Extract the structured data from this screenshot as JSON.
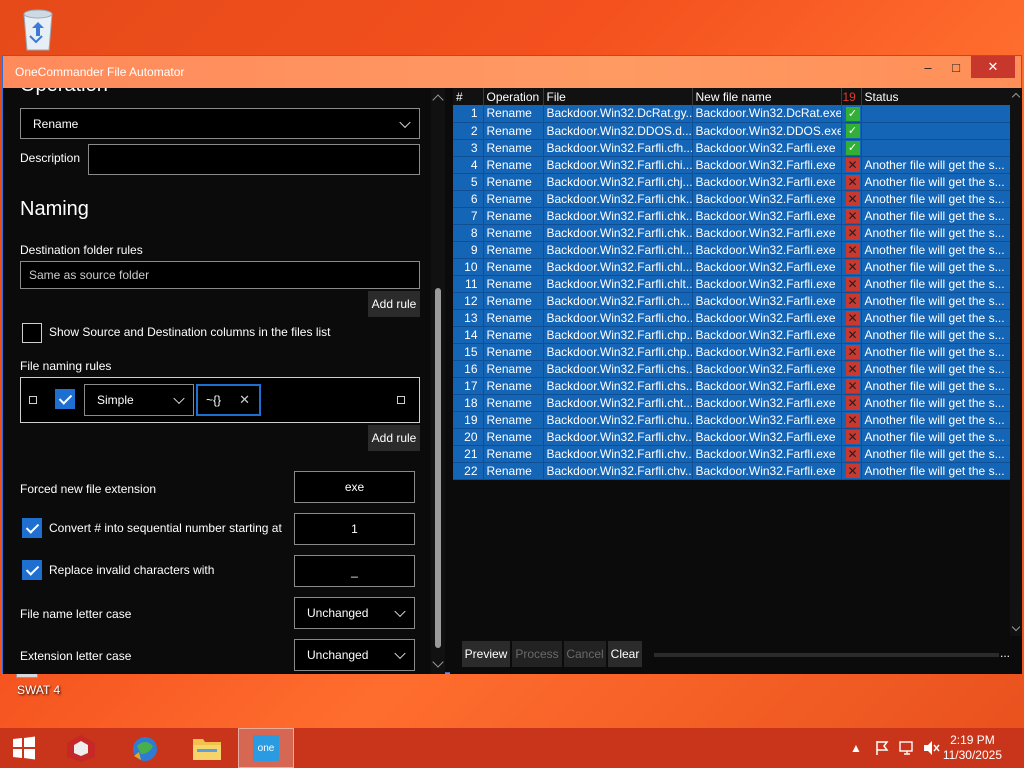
{
  "desktop": {
    "icons": [
      {
        "name": "Recycle Bin",
        "label": ""
      },
      {
        "name": "SWAT 4",
        "label": "SWAT 4"
      }
    ]
  },
  "window": {
    "title": "OneCommander File Automator",
    "controls": {
      "minimize": "–",
      "maximize": "□",
      "close": "✕"
    }
  },
  "left": {
    "operation_heading": "Operation",
    "operation_value": "Rename",
    "description_label": "Description",
    "description_value": "",
    "naming_heading": "Naming",
    "dest_rules_label": "Destination folder rules",
    "dest_rules_value": "Same as source folder",
    "add_rule_label": "Add rule",
    "show_cols_label": "Show Source and Destination columns in the files list",
    "show_cols_checked": false,
    "file_naming_label": "File naming rules",
    "rule": {
      "enabled": true,
      "mode": "Simple",
      "pattern": "~{}"
    },
    "add_rule2_label": "Add rule",
    "forced_ext_label": "Forced new file extension",
    "forced_ext_value": "exe",
    "convert_label": "Convert # into sequential number starting at",
    "convert_checked": true,
    "convert_value": "1",
    "replace_label": "Replace invalid characters with",
    "replace_checked": true,
    "replace_value": "_",
    "name_case_label": "File name letter case",
    "name_case_value": "Unchanged",
    "ext_case_label": "Extension letter case",
    "ext_case_value": "Unchanged"
  },
  "grid": {
    "headers": {
      "num": "#",
      "operation": "Operation",
      "file": "File",
      "new_name": "New file name",
      "count": "19",
      "status": "Status"
    },
    "rows": [
      {
        "n": "1",
        "op": "Rename",
        "file": "Backdoor.Win32.DcRat.gy...",
        "new": "Backdoor.Win32.DcRat.exe",
        "ok": true,
        "status": ""
      },
      {
        "n": "2",
        "op": "Rename",
        "file": "Backdoor.Win32.DDOS.d...",
        "new": "Backdoor.Win32.DDOS.exe",
        "ok": true,
        "status": ""
      },
      {
        "n": "3",
        "op": "Rename",
        "file": "Backdoor.Win32.Farfli.cfh...",
        "new": "Backdoor.Win32.Farfli.exe",
        "ok": true,
        "status": ""
      },
      {
        "n": "4",
        "op": "Rename",
        "file": "Backdoor.Win32.Farfli.chi...",
        "new": "Backdoor.Win32.Farfli.exe",
        "ok": false,
        "status": "Another file will get the s..."
      },
      {
        "n": "5",
        "op": "Rename",
        "file": "Backdoor.Win32.Farfli.chj...",
        "new": "Backdoor.Win32.Farfli.exe",
        "ok": false,
        "status": "Another file will get the s..."
      },
      {
        "n": "6",
        "op": "Rename",
        "file": "Backdoor.Win32.Farfli.chk...",
        "new": "Backdoor.Win32.Farfli.exe",
        "ok": false,
        "status": "Another file will get the s..."
      },
      {
        "n": "7",
        "op": "Rename",
        "file": "Backdoor.Win32.Farfli.chk...",
        "new": "Backdoor.Win32.Farfli.exe",
        "ok": false,
        "status": "Another file will get the s..."
      },
      {
        "n": "8",
        "op": "Rename",
        "file": "Backdoor.Win32.Farfli.chk...",
        "new": "Backdoor.Win32.Farfli.exe",
        "ok": false,
        "status": "Another file will get the s..."
      },
      {
        "n": "9",
        "op": "Rename",
        "file": "Backdoor.Win32.Farfli.chl...",
        "new": "Backdoor.Win32.Farfli.exe",
        "ok": false,
        "status": "Another file will get the s..."
      },
      {
        "n": "10",
        "op": "Rename",
        "file": "Backdoor.Win32.Farfli.chl...",
        "new": "Backdoor.Win32.Farfli.exe",
        "ok": false,
        "status": "Another file will get the s..."
      },
      {
        "n": "11",
        "op": "Rename",
        "file": "Backdoor.Win32.Farfli.chlt...",
        "new": "Backdoor.Win32.Farfli.exe",
        "ok": false,
        "status": "Another file will get the s..."
      },
      {
        "n": "12",
        "op": "Rename",
        "file": "Backdoor.Win32.Farfli.ch...",
        "new": "Backdoor.Win32.Farfli.exe",
        "ok": false,
        "status": "Another file will get the s..."
      },
      {
        "n": "13",
        "op": "Rename",
        "file": "Backdoor.Win32.Farfli.cho...",
        "new": "Backdoor.Win32.Farfli.exe",
        "ok": false,
        "status": "Another file will get the s..."
      },
      {
        "n": "14",
        "op": "Rename",
        "file": "Backdoor.Win32.Farfli.chp...",
        "new": "Backdoor.Win32.Farfli.exe",
        "ok": false,
        "status": "Another file will get the s..."
      },
      {
        "n": "15",
        "op": "Rename",
        "file": "Backdoor.Win32.Farfli.chp...",
        "new": "Backdoor.Win32.Farfli.exe",
        "ok": false,
        "status": "Another file will get the s..."
      },
      {
        "n": "16",
        "op": "Rename",
        "file": "Backdoor.Win32.Farfli.chs...",
        "new": "Backdoor.Win32.Farfli.exe",
        "ok": false,
        "status": "Another file will get the s..."
      },
      {
        "n": "17",
        "op": "Rename",
        "file": "Backdoor.Win32.Farfli.chs...",
        "new": "Backdoor.Win32.Farfli.exe",
        "ok": false,
        "status": "Another file will get the s..."
      },
      {
        "n": "18",
        "op": "Rename",
        "file": "Backdoor.Win32.Farfli.cht...",
        "new": "Backdoor.Win32.Farfli.exe",
        "ok": false,
        "status": "Another file will get the s..."
      },
      {
        "n": "19",
        "op": "Rename",
        "file": "Backdoor.Win32.Farfli.chu...",
        "new": "Backdoor.Win32.Farfli.exe",
        "ok": false,
        "status": "Another file will get the s..."
      },
      {
        "n": "20",
        "op": "Rename",
        "file": "Backdoor.Win32.Farfli.chv...",
        "new": "Backdoor.Win32.Farfli.exe",
        "ok": false,
        "status": "Another file will get the s..."
      },
      {
        "n": "21",
        "op": "Rename",
        "file": "Backdoor.Win32.Farfli.chv...",
        "new": "Backdoor.Win32.Farfli.exe",
        "ok": false,
        "status": "Another file will get the s..."
      },
      {
        "n": "22",
        "op": "Rename",
        "file": "Backdoor.Win32.Farfli.chv...",
        "new": "Backdoor.Win32.Farfli.exe",
        "ok": false,
        "status": "Another file will get the s..."
      }
    ]
  },
  "actions": {
    "preview": "Preview",
    "process": "Process",
    "cancel": "Cancel",
    "clear": "Clear",
    "more": "..."
  },
  "taskbar": {
    "time": "2:19 PM",
    "date": "11/30/2025",
    "active_app_label": "one"
  }
}
